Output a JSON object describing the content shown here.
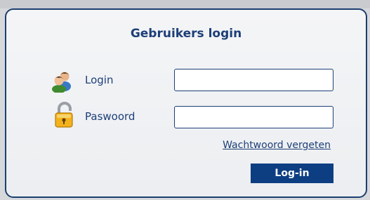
{
  "form": {
    "title": "Gebruikers login",
    "login": {
      "label": "Login",
      "icon": "users-icon",
      "value": "",
      "placeholder": ""
    },
    "password": {
      "label": "Paswoord",
      "icon": "padlock-icon",
      "value": "",
      "placeholder": ""
    },
    "forgot_link": "Wachtwoord vergeten",
    "submit_label": "Log-in"
  },
  "colors": {
    "accent": "#1d3f78",
    "button_bg": "#0d3e82",
    "panel_border": "#1c3f6e"
  }
}
